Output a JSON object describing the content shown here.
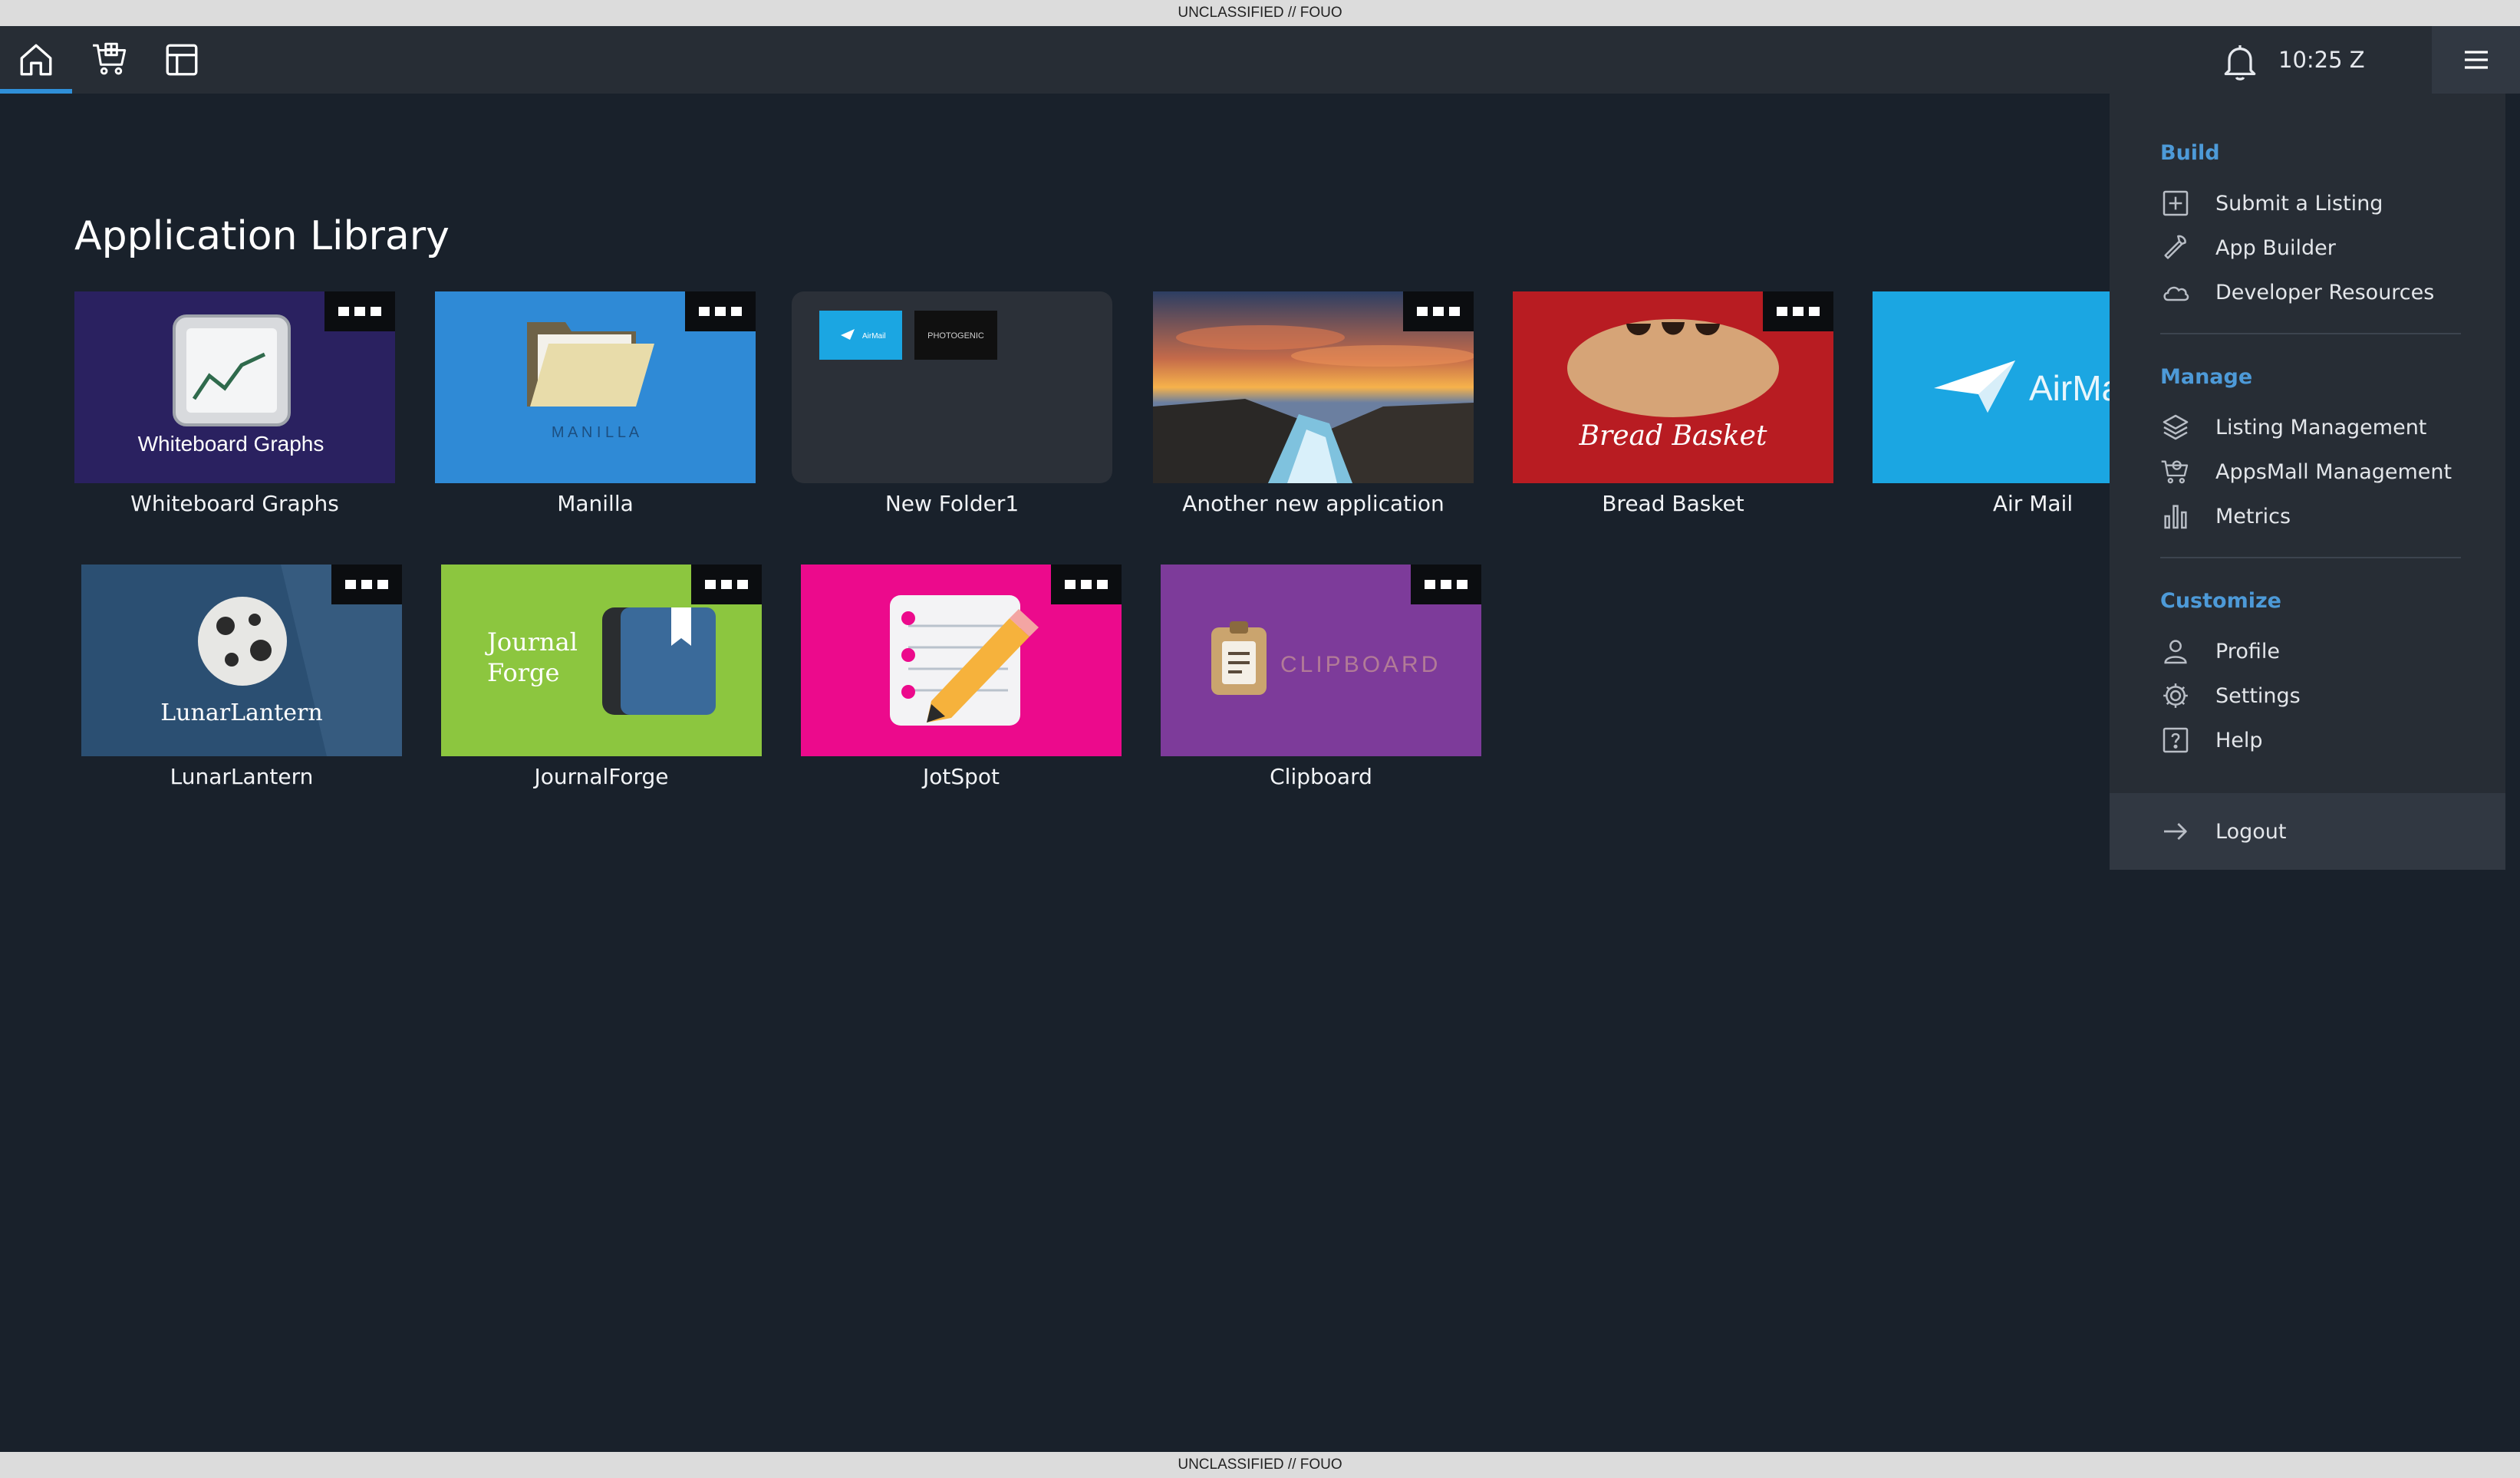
{
  "banner": {
    "top": "UNCLASSIFIED // FOUO",
    "bottom": "UNCLASSIFIED // FOUO"
  },
  "topbar": {
    "nav": [
      {
        "id": "home",
        "icon": "home-icon",
        "active": true
      },
      {
        "id": "store",
        "icon": "cart-icon",
        "active": false
      },
      {
        "id": "layout",
        "icon": "layout-icon",
        "active": false
      }
    ],
    "notifications_icon": "bell-icon",
    "clock": "10:25 Z",
    "menu_icon": "hamburger-icon"
  },
  "page": {
    "title": "Application Library"
  },
  "tiles": [
    {
      "name": "Whiteboard Graphs",
      "logo_text": "Whiteboard Graphs",
      "bg": "#2a2160"
    },
    {
      "name": "Manilla",
      "logo_text": "M A N I L L A",
      "bg": "#2f8ad6"
    },
    {
      "name": "New Folder1",
      "folder": true,
      "folder_items": [
        "AirMail",
        "PHOTOGENIC"
      ]
    },
    {
      "name": "Another new application",
      "bg": "#3b3a3a"
    },
    {
      "name": "Bread Basket",
      "logo_text": "Bread Basket",
      "bg": "#b81c22"
    },
    {
      "name": "Air Mail",
      "logo_text": "AirMa",
      "bg": "#1ba6e2"
    },
    {
      "name": "LunarLantern",
      "logo_text": "LunarLantern",
      "bg": "#2b4f72"
    },
    {
      "name": "JournalForge",
      "logo_text": "Journal Forge",
      "bg": "#8cc63f"
    },
    {
      "name": "JotSpot",
      "bg": "#ec0a8c"
    },
    {
      "name": "Clipboard",
      "logo_text": "CLIPBOARD",
      "bg": "#7d3b9a"
    }
  ],
  "menu": {
    "sections": [
      {
        "title": "Build",
        "items": [
          {
            "label": "Submit a Listing",
            "icon": "plus-square-icon"
          },
          {
            "label": "App Builder",
            "icon": "wrench-icon"
          },
          {
            "label": "Developer Resources",
            "icon": "cloud-icon"
          }
        ]
      },
      {
        "title": "Manage",
        "items": [
          {
            "label": "Listing Management",
            "icon": "layers-icon"
          },
          {
            "label": "AppsMall Management",
            "icon": "cart-gear-icon"
          },
          {
            "label": "Metrics",
            "icon": "bar-chart-icon"
          }
        ]
      },
      {
        "title": "Customize",
        "items": [
          {
            "label": "Profile",
            "icon": "user-icon"
          },
          {
            "label": "Settings",
            "icon": "gear-icon"
          },
          {
            "label": "Help",
            "icon": "help-icon"
          }
        ]
      }
    ],
    "logout": {
      "label": "Logout",
      "icon": "arrow-right-icon"
    }
  },
  "colors": {
    "background": "#19212b",
    "topbar": "#272d35",
    "accent": "#4d9ad8",
    "active_underline": "#2f8fd8"
  }
}
